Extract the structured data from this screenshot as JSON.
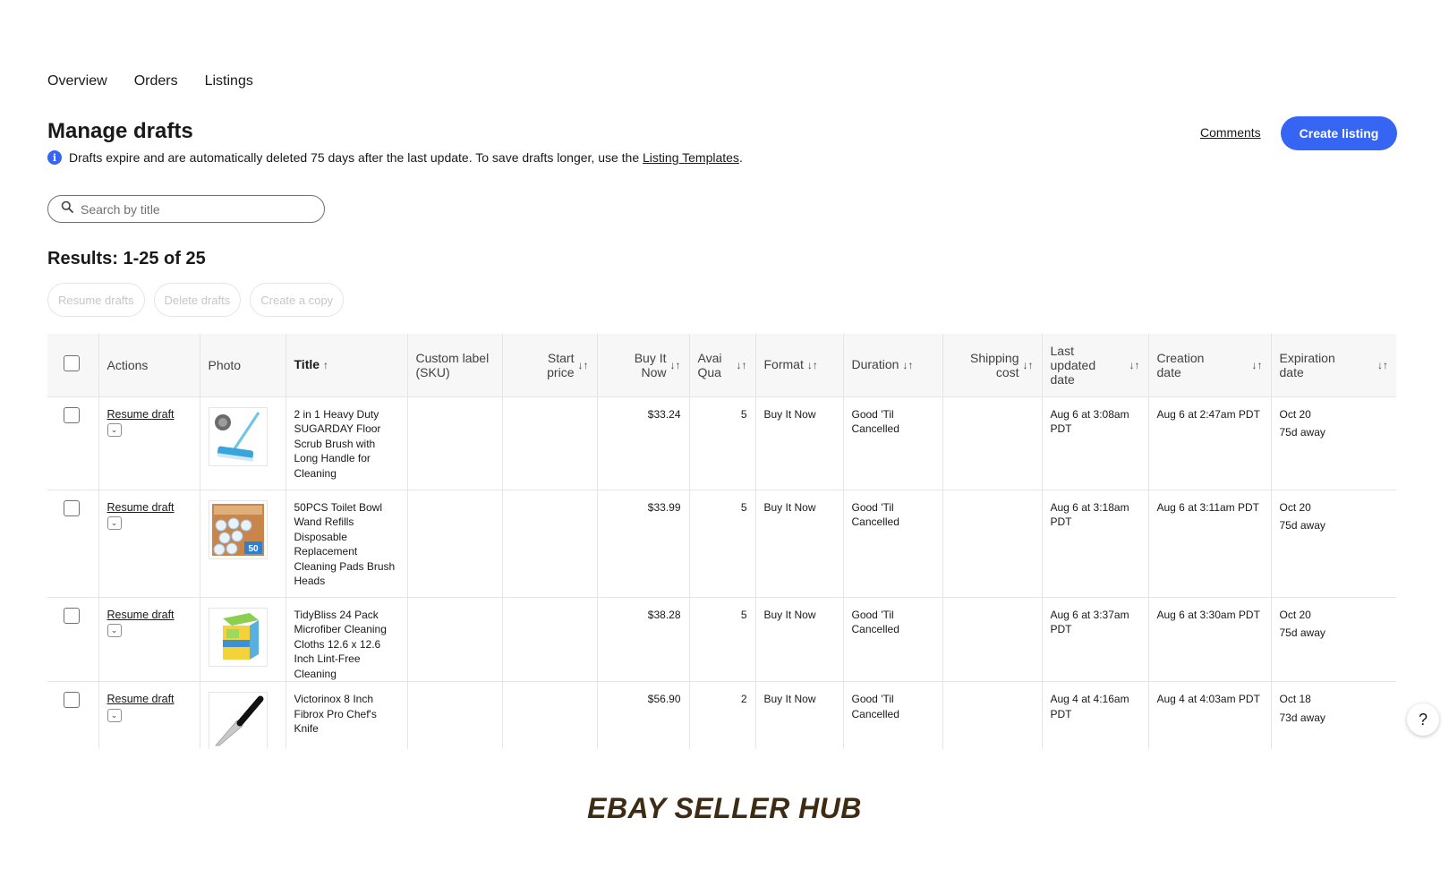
{
  "nav": {
    "tabs": [
      "Overview",
      "Orders",
      "Listings"
    ]
  },
  "page": {
    "title": "Manage drafts",
    "info_text": "Drafts expire and are automatically deleted 75 days after the last update. To save drafts longer, use the ",
    "info_link": "Listing Templates",
    "info_end": ".",
    "comments_label": "Comments",
    "create_label": "Create listing"
  },
  "search": {
    "placeholder": "Search by title"
  },
  "results": {
    "label": "Results: 1-25 of 25"
  },
  "bulk_actions": [
    "Resume drafts",
    "Delete drafts",
    "Create a copy"
  ],
  "columns": {
    "actions": "Actions",
    "photo": "Photo",
    "title": "Title",
    "sku_1": "Custom label",
    "sku_2": "(SKU)",
    "start_1": "Start",
    "start_2": "price",
    "bin_1": "Buy It",
    "bin_2": "Now",
    "qty_1": "Avai",
    "qty_2": "Qua",
    "format": "Format",
    "duration": "Duration",
    "ship_1": "Shipping",
    "ship_2": "cost",
    "updated_1": "Last",
    "updated_2": "updated",
    "updated_3": "date",
    "created_1": "Creation",
    "created_2": "date",
    "expires_1": "Expiration",
    "expires_2": "date"
  },
  "rows": [
    {
      "action": "Resume draft",
      "title": "2 in 1 Heavy Duty SUGARDAY Floor Scrub Brush with Long Handle for Cleaning",
      "sku": "",
      "start_price": "",
      "buy_it_now": "$33.24",
      "qty": "5",
      "format": "Buy It Now",
      "duration": "Good 'Til Cancelled",
      "shipping": "",
      "updated": "Aug 6 at 3:08am PDT",
      "created": "Aug 6 at 2:47am PDT",
      "expires": "Oct 20",
      "expires_away": "75d away",
      "photo_icon": "scrub-brush"
    },
    {
      "action": "Resume draft",
      "title": "50PCS Toilet Bowl Wand Refills Disposable Replacement Cleaning Pads Brush Heads",
      "sku": "",
      "start_price": "",
      "buy_it_now": "$33.99",
      "qty": "5",
      "format": "Buy It Now",
      "duration": "Good 'Til Cancelled",
      "shipping": "",
      "updated": "Aug 6 at 3:18am PDT",
      "created": "Aug 6 at 3:11am PDT",
      "expires": "Oct 20",
      "expires_away": "75d away",
      "photo_icon": "toilet-pads",
      "photo_badge": "50"
    },
    {
      "action": "Resume draft",
      "title": "TidyBliss 24 Pack Microfiber Cleaning Cloths 12.6 x 12.6 Inch Lint-Free Cleaning",
      "sku": "",
      "start_price": "",
      "buy_it_now": "$38.28",
      "qty": "5",
      "format": "Buy It Now",
      "duration": "Good 'Til Cancelled",
      "shipping": "",
      "updated": "Aug 6 at 3:37am PDT",
      "created": "Aug 6 at 3:30am PDT",
      "expires": "Oct 20",
      "expires_away": "75d away",
      "photo_icon": "microfiber-cloths"
    },
    {
      "action": "Resume draft",
      "title": "Victorinox 8 Inch Fibrox Pro Chef's Knife",
      "sku": "",
      "start_price": "",
      "buy_it_now": "$56.90",
      "qty": "2",
      "format": "Buy It Now",
      "duration": "Good 'Til Cancelled",
      "shipping": "",
      "updated": "Aug 4 at 4:16am PDT",
      "created": "Aug 4 at 4:03am PDT",
      "expires": "Oct 18",
      "expires_away": "73d away",
      "photo_icon": "chef-knife"
    }
  ],
  "help": {
    "label": "?"
  },
  "footer": {
    "caption": "EBAY SELLER HUB"
  },
  "colors": {
    "accent": "#3665f3",
    "caption": "#3d2b14"
  }
}
